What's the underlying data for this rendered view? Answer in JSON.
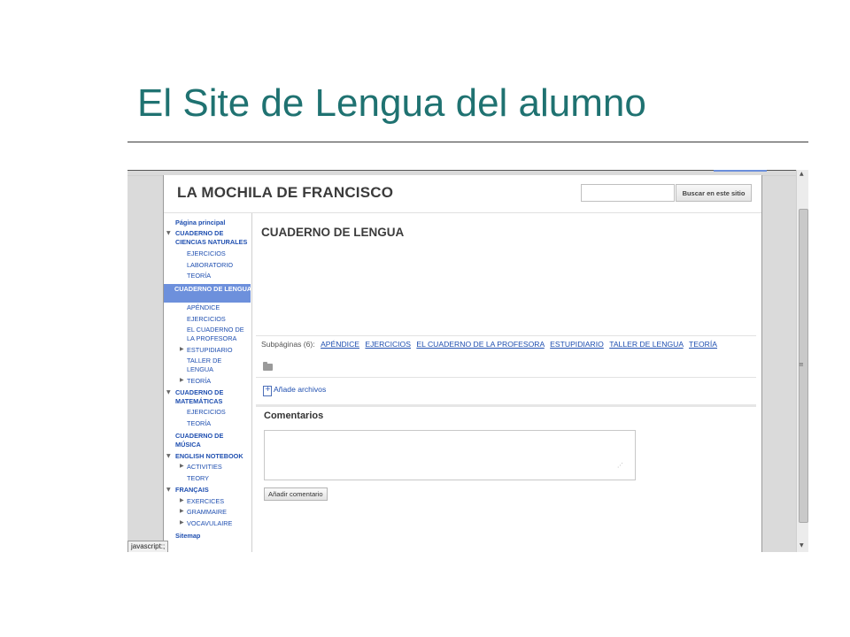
{
  "slide": {
    "title": "El Site de Lengua del alumno"
  },
  "site": {
    "name": "LA MOCHILA DE FRANCISCO",
    "search_placeholder": "",
    "search_button": "Buscar en este sitio"
  },
  "sidebar": {
    "items": [
      {
        "label": "Página principal"
      },
      {
        "label": "CUADERNO DE CIENCIAS NATURALES"
      },
      {
        "label": "EJERCICIOS"
      },
      {
        "label": "LABORATORIO"
      },
      {
        "label": "TEORÍA"
      },
      {
        "label": "CUADERNO DE LENGUA"
      },
      {
        "label": "APÉNDICE"
      },
      {
        "label": "EJERCICIOS"
      },
      {
        "label": "EL CUADERNO DE LA PROFESORA"
      },
      {
        "label": "ESTUPIDIARIO"
      },
      {
        "label": "TALLER DE LENGUA"
      },
      {
        "label": "TEORÍA"
      },
      {
        "label": "CUADERNO DE MATEMÁTICAS"
      },
      {
        "label": "EJERCICIOS"
      },
      {
        "label": "TEORÍA"
      },
      {
        "label": "CUADERNO DE MÚSICA"
      },
      {
        "label": "ENGLISH NOTEBOOK"
      },
      {
        "label": "ACTIVITIES"
      },
      {
        "label": "TEORY"
      },
      {
        "label": "FRANÇAIS"
      },
      {
        "label": "EXERCICES"
      },
      {
        "label": "GRAMMAIRE"
      },
      {
        "label": "VOCAVULAIRE"
      },
      {
        "label": "Sitemap"
      }
    ]
  },
  "main": {
    "page_title": "CUADERNO DE LENGUA",
    "subpages_label": "Subpáginas (6):",
    "subpages": [
      {
        "label": "APÉNDICE"
      },
      {
        "label": "EJERCICIOS"
      },
      {
        "label": "EL CUADERNO DE LA PROFESORA"
      },
      {
        "label": "ESTUPIDIARIO"
      },
      {
        "label": "TALLER DE LENGUA"
      },
      {
        "label": "TEORÍA"
      }
    ],
    "add_files": "Añade archivos",
    "comments_title": "Comentarios",
    "add_comment": "Añadir comentario"
  },
  "status_bar": {
    "text": "javascript:;"
  },
  "icons": {
    "expanded": "triangle-down-icon",
    "collapsed": "triangle-right-icon",
    "folder": "folder-icon",
    "file": "add-file-icon"
  },
  "colors": {
    "title": "#1f7271",
    "link": "#1f4fb0",
    "selected_nav": "#6d90dc"
  }
}
